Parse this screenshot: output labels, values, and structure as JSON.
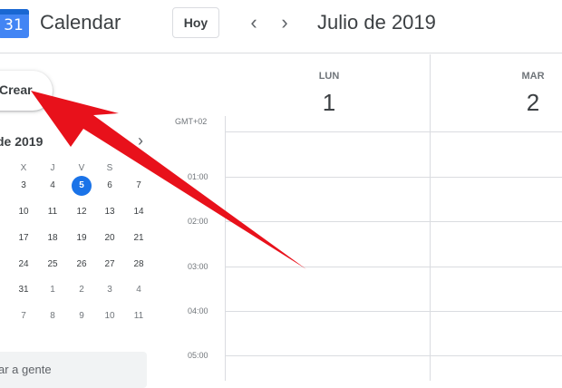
{
  "header": {
    "logo_number": "31",
    "app_title": "Calendar",
    "today_label": "Hoy",
    "prev_glyph": "‹",
    "next_glyph": "›",
    "month_title": "Julio de 2019"
  },
  "sidebar": {
    "create_label": "Crear",
    "mini_calendar": {
      "title": "de 2019",
      "next_glyph": "›",
      "weekdays": [
        "X",
        "J",
        "V",
        "S"
      ],
      "rows": [
        [
          "3",
          "4",
          "5",
          "6",
          "7"
        ],
        [
          "10",
          "11",
          "12",
          "13",
          "14"
        ],
        [
          "17",
          "18",
          "19",
          "20",
          "21"
        ],
        [
          "24",
          "25",
          "26",
          "27",
          "28"
        ],
        [
          "31",
          "1",
          "2",
          "3",
          "4"
        ],
        [
          "7",
          "8",
          "9",
          "10",
          "11"
        ]
      ],
      "today": "5"
    },
    "people_search_label": "ar a gente"
  },
  "week": {
    "days": [
      {
        "dow": "LUN",
        "date": "1"
      },
      {
        "dow": "MAR",
        "date": "2"
      }
    ],
    "timezone": "GMT+02",
    "hours": [
      "01:00",
      "02:00",
      "03:00",
      "04:00",
      "05:00"
    ]
  },
  "colors": {
    "accent": "#1a73e8",
    "annotation_arrow": "#e8111b"
  },
  "icons": {
    "logo": "calendar-logo-icon",
    "prev": "chevron-left-icon",
    "next": "chevron-right-icon",
    "annotation": "red-arrow-annotation"
  }
}
